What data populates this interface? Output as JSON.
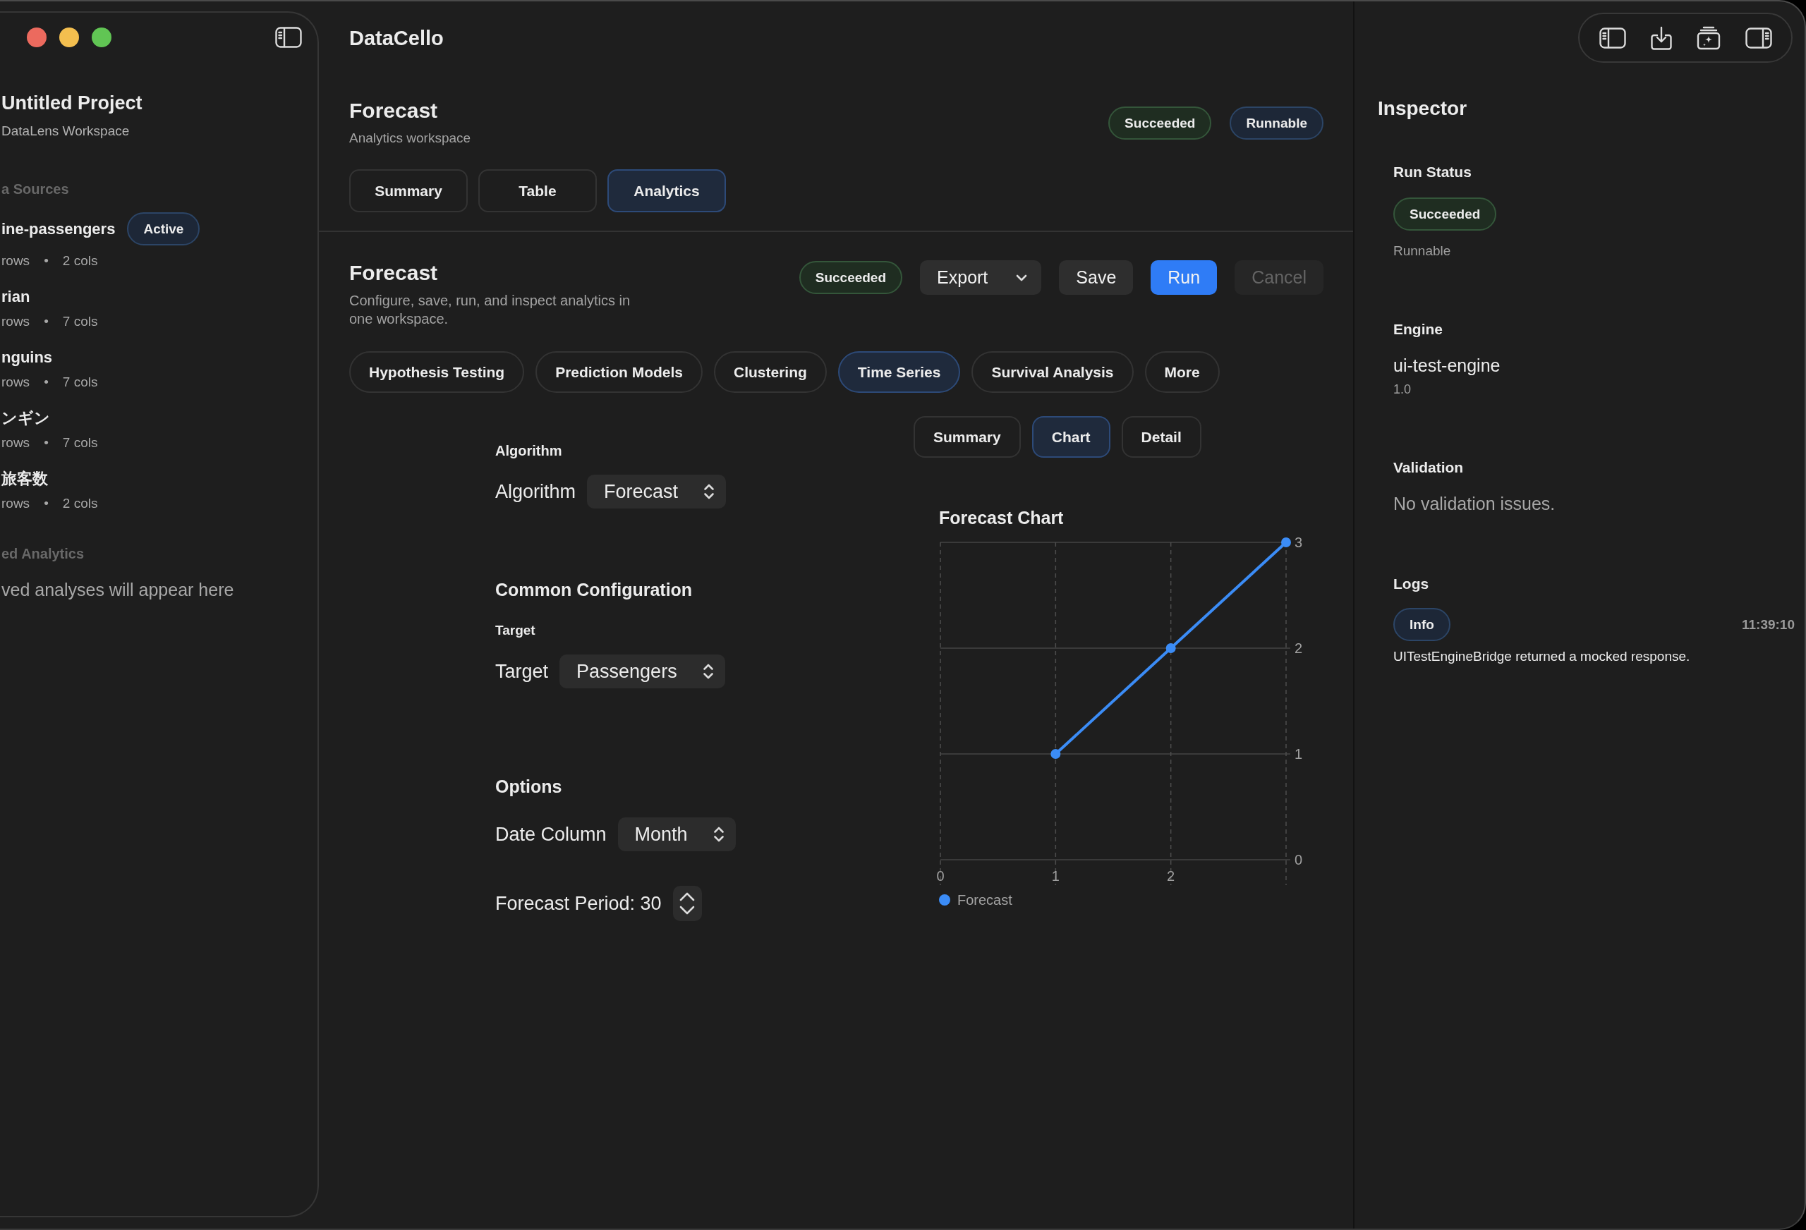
{
  "window": {
    "title": "DataCello"
  },
  "sidebar": {
    "project": {
      "name": "Untitled Project",
      "workspace": "DataLens Workspace"
    },
    "data_sources": {
      "heading": "a Sources",
      "items": [
        {
          "name": "ine-passengers",
          "badge": "Active",
          "rows": "rows",
          "separator": "•",
          "cols": "2 cols"
        },
        {
          "name": "rian",
          "rows": "rows",
          "separator": "•",
          "cols": "7 cols"
        },
        {
          "name": "nguins",
          "rows": "rows",
          "separator": "•",
          "cols": "7 cols"
        },
        {
          "name": "ンギン",
          "rows": "rows",
          "separator": "•",
          "cols": "7 cols"
        },
        {
          "name": "旅客数",
          "rows": "rows",
          "separator": "•",
          "cols": "2 cols"
        }
      ]
    },
    "saved_analytics": {
      "heading": "ed Analytics",
      "empty_message": "ved analyses will appear here"
    }
  },
  "header": {
    "title": "Forecast",
    "subtitle": "Analytics workspace",
    "badges": [
      {
        "label": "Succeeded",
        "kind": "success"
      },
      {
        "label": "Runnable",
        "kind": "info"
      }
    ],
    "tabs": [
      {
        "label": "Summary",
        "selected": false
      },
      {
        "label": "Table",
        "selected": false
      },
      {
        "label": "Analytics",
        "selected": true
      }
    ]
  },
  "analysis": {
    "title": "Forecast",
    "description": "Configure, save, run, and inspect analytics in one workspace.",
    "status": {
      "label": "Succeeded",
      "kind": "success"
    },
    "actions": [
      {
        "label": "Export",
        "kind": "menu",
        "disabled": false
      },
      {
        "label": "Save",
        "kind": "plain",
        "disabled": false
      },
      {
        "label": "Run",
        "kind": "primary",
        "disabled": false
      },
      {
        "label": "Cancel",
        "kind": "plain",
        "disabled": true
      }
    ],
    "categories": [
      {
        "label": "Hypothesis Testing",
        "selected": false
      },
      {
        "label": "Prediction Models",
        "selected": false
      },
      {
        "label": "Clustering",
        "selected": false
      },
      {
        "label": "Time Series",
        "selected": true
      },
      {
        "label": "Survival Analysis",
        "selected": false
      },
      {
        "label": "More",
        "selected": false
      }
    ],
    "config_sections": [
      {
        "kind": "minor",
        "heading": "Algorithm",
        "fields": [
          {
            "kind": "select",
            "label": "Algorithm",
            "value": "Forecast"
          }
        ]
      },
      {
        "kind": "major",
        "heading": "Common Configuration",
        "subheading": "Target",
        "fields": [
          {
            "kind": "select",
            "label": "Target",
            "value": "Passengers"
          }
        ]
      },
      {
        "kind": "major",
        "heading": "Options",
        "fields": [
          {
            "kind": "select",
            "label": "Date Column",
            "value": "Month"
          },
          {
            "kind": "stepper",
            "label": "Forecast Period: 30"
          }
        ]
      }
    ],
    "result_tabs": [
      {
        "label": "Summary",
        "selected": false
      },
      {
        "label": "Chart",
        "selected": true
      },
      {
        "label": "Detail",
        "selected": false
      }
    ],
    "chart_data": {
      "type": "line",
      "title": "Forecast Chart",
      "x": [
        1,
        2,
        3
      ],
      "series": [
        {
          "name": "Forecast",
          "color": "#3b8cf6",
          "marker": "circle",
          "values": [
            1,
            2,
            3
          ]
        }
      ],
      "xlim": [
        0,
        3
      ],
      "ylim": [
        0,
        3
      ],
      "xticks": [
        0,
        1,
        2
      ],
      "yticks": [
        0,
        1,
        2,
        3
      ],
      "grid": true
    }
  },
  "inspector": {
    "title": "Inspector",
    "run_status": {
      "heading": "Run Status",
      "badge": {
        "label": "Succeeded",
        "kind": "success"
      },
      "note": "Runnable"
    },
    "engine": {
      "heading": "Engine",
      "name": "ui-test-engine",
      "version": "1.0"
    },
    "validation": {
      "heading": "Validation",
      "message": "No validation issues."
    },
    "logs": {
      "heading": "Logs",
      "entries": [
        {
          "level": "Info",
          "kind": "info",
          "time": "11:39:10",
          "message": "UITestEngineBridge returned a mocked response."
        }
      ]
    }
  }
}
